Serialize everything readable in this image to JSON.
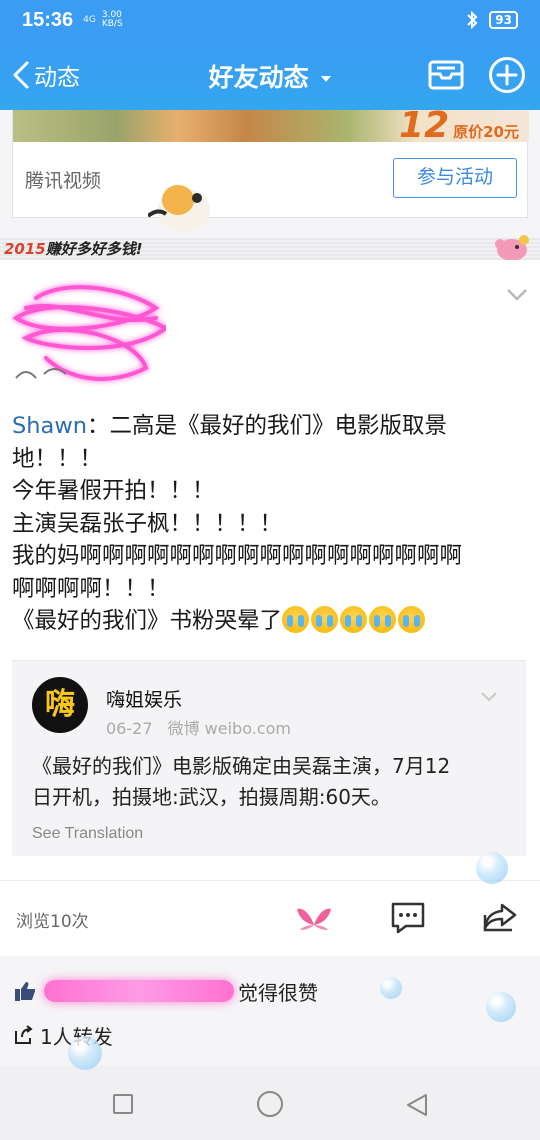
{
  "status_bar": {
    "time": "15:36",
    "network": "4G",
    "speed_value": "3.00",
    "speed_unit": "KB/S",
    "battery": "93"
  },
  "nav": {
    "back_label": "动态",
    "title": "好友动态"
  },
  "ad": {
    "price_big": "12",
    "price_small": "原价20元",
    "source": "腾讯视频",
    "button": "参与活动"
  },
  "banner": {
    "text_year": "2015",
    "text_rest": "赚好多好多钱!"
  },
  "post": {
    "author": "Shawn",
    "text_lines": [
      "：二高是《最好的我们》电影版取景",
      "地！！！",
      "今年暑假开拍！！！",
      "主演吴磊张子枫！！！！！",
      "我的妈啊啊啊啊啊啊啊啊啊啊啊啊啊啊啊啊啊",
      "啊啊啊啊！！！",
      "《最好的我们》书粉哭晕了"
    ],
    "shared": {
      "logo_char": "嗨",
      "name": "嗨姐娱乐",
      "date": "06-27",
      "source": "微博 weibo.com",
      "text_line1": "《最好的我们》电影版确定由吴磊主演，7月12",
      "text_line2": "日开机，拍摄地:武汉，拍摄周期:60天。",
      "translate": "See Translation"
    }
  },
  "actions": {
    "views": "浏览10次"
  },
  "social": {
    "likes_suffix": "觉得很赞",
    "forwards": "1人转发"
  },
  "colors": {
    "nav_blue": "#3a9cf2",
    "author_blue": "#2a6db0",
    "like_pink": "#f0609a"
  }
}
